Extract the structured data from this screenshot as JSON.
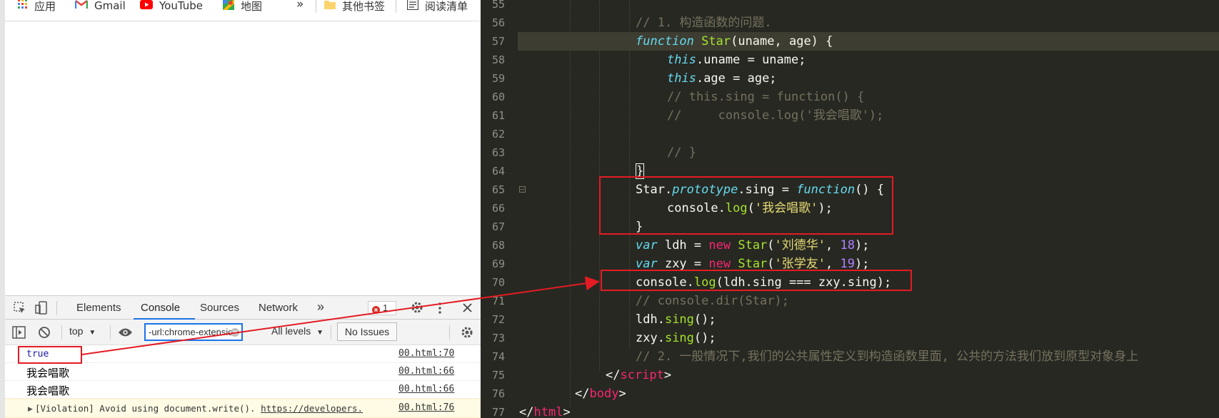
{
  "bookmarks": {
    "items": [
      {
        "label": "应用",
        "icon": "apps-grid-icon"
      },
      {
        "label": "Gmail",
        "icon": "gmail-icon"
      },
      {
        "label": "YouTube",
        "icon": "youtube-icon"
      },
      {
        "label": "地图",
        "icon": "maps-icon"
      }
    ],
    "overflow": "»",
    "folder": {
      "label": "其他书签",
      "icon": "folder-icon"
    },
    "reading_list": {
      "label": "阅读清单",
      "icon": "reading-list-icon"
    }
  },
  "devtools": {
    "tabs": [
      "Elements",
      "Console",
      "Sources",
      "Network"
    ],
    "active_tab": "Console",
    "more_tabs": "»",
    "error_count": "1",
    "context": "top",
    "filter_value": "-url:chrome-extensio",
    "levels": "All levels",
    "no_issues": "No Issues"
  },
  "console_rows": [
    {
      "message": "true",
      "source": "00.html:70",
      "type": "value"
    },
    {
      "message": "我会唱歌",
      "source": "00.html:66",
      "type": "log"
    },
    {
      "message": "我会唱歌",
      "source": "00.html:66",
      "type": "log"
    },
    {
      "message": "[Violation] Avoid using document.write().",
      "link": "https://developers.",
      "source": "00.html:76",
      "type": "violation"
    }
  ],
  "editor": {
    "line_numbers": [
      "55",
      "56",
      "57",
      "58",
      "59",
      "60",
      "61",
      "62",
      "63",
      "64",
      "65",
      "66",
      "67",
      "68",
      "69",
      "70",
      "71",
      "72",
      "73",
      "74",
      "75",
      "76",
      "77"
    ],
    "strings": {
      "c56": "// 1. 构造函数的问题.",
      "kw_function": "function",
      "name_star": "Star",
      "params": "(uname, age) {",
      "kw_this": "this",
      "l58_rest": ".uname = uname;",
      "l59_rest": ".age = age;",
      "c60": "// this.sing = function() {",
      "c61": "//     console.log('我会唱歌');",
      "c63": "// }",
      "brace_close": "}",
      "l65_star": "Star.",
      "l65_proto": "prototype",
      "l65_mid": ".sing = ",
      "l65_end": "() {",
      "console_dot": "console.",
      "log_fn": "log",
      "l66_open": "(",
      "str_sing": "'我会唱歌'",
      "l66_close": ");",
      "kw_var": "var",
      "l68_mid": " ldh = ",
      "kw_new": "new",
      "sp": " ",
      "str_ldh": "'刘德华'",
      "comma": ", ",
      "num_18": "18",
      "close_paren": ");",
      "l69_mid": " zxy = ",
      "str_zxy": "'张学友'",
      "num_19": "19",
      "l70_args": "(ldh.sing === zxy.sing);",
      "c71": "// console.dir(Star);",
      "ldh_dot": "ldh.",
      "zxy_dot": "zxy.",
      "sing_fn": "sing",
      "call_end": "();",
      "c74": "// 2. 一般情况下,我们的公共属性定义到构造函数里面, 公共的方法我们放到原型对象身上",
      "lt_slash": "</",
      "tag_script": "script",
      "tag_body": "body",
      "tag_html": "html",
      "gt": ">"
    }
  }
}
